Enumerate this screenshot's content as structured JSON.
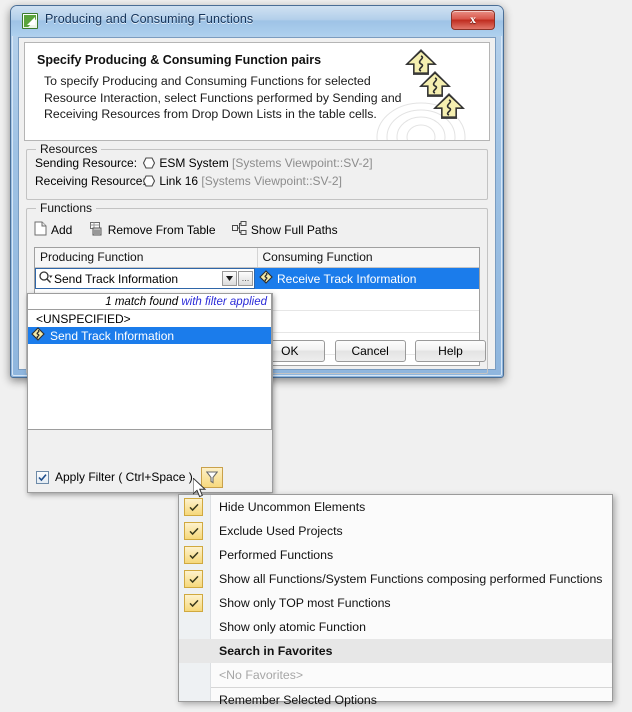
{
  "window": {
    "title": "Producing and Consuming Functions",
    "icon": "app-icon",
    "close_label": "x"
  },
  "banner": {
    "heading": "Specify Producing & Consuming Function pairs",
    "description": "To specify Producing and Consuming Functions for selected Resource Interaction, select Functions performed by Sending and Receiving Resources from Drop Down Lists in the table cells."
  },
  "resources": {
    "legend": "Resources",
    "rows": [
      {
        "label": "Sending Resource:",
        "name": "ESM System",
        "path": "[Systems Viewpoint::SV-2]"
      },
      {
        "label": "Receiving Resource:",
        "name": "Link 16",
        "path": "[Systems Viewpoint::SV-2]"
      }
    ]
  },
  "functions": {
    "legend": "Functions",
    "toolbar": [
      {
        "icon": "new-document-icon",
        "label": "Add"
      },
      {
        "icon": "remove-row-icon",
        "label": "Remove From Table"
      },
      {
        "icon": "show-full-paths-icon",
        "label": "Show Full Paths"
      }
    ],
    "table": {
      "columns": [
        "Producing Function",
        "Consuming Function"
      ],
      "rows": [
        {
          "producing": "Send Track Information",
          "consuming": "Receive Track Information",
          "consuming_selected": true
        }
      ]
    }
  },
  "editor": {
    "search_value": "Send Track Information",
    "search_placeholder": "",
    "dropdown_arrow": "▼",
    "ellipsis_label": "…"
  },
  "dropdown": {
    "match_prefix": "1 match found ",
    "match_suffix": "with filter applied",
    "items": [
      {
        "label": "<UNSPECIFIED>",
        "icon": "none",
        "selected": false
      },
      {
        "label": "Send Track Information",
        "icon": "function-icon",
        "selected": true
      }
    ],
    "apply_filter_label": "Apply Filter ( Ctrl+Space )",
    "apply_filter_checked": true,
    "filter_button_icon": "funnel-icon"
  },
  "dialog_buttons": [
    {
      "label": "OK"
    },
    {
      "label": "Cancel"
    },
    {
      "label": "Help"
    }
  ],
  "context_menu": {
    "items": [
      {
        "label": "Hide Uncommon Elements",
        "checked": true,
        "type": "check"
      },
      {
        "label": "Exclude Used Projects",
        "checked": true,
        "type": "check"
      },
      {
        "label": "Performed Functions",
        "checked": true,
        "type": "check"
      },
      {
        "label": "Show all Functions/System Functions composing performed Functions",
        "checked": true,
        "type": "check"
      },
      {
        "label": "Show only TOP most Functions",
        "checked": true,
        "type": "check"
      },
      {
        "label": "Show only atomic Function",
        "checked": false,
        "type": "check"
      },
      {
        "label": "Search in Favorites",
        "checked": false,
        "type": "header"
      },
      {
        "label": "<No Favorites>",
        "checked": false,
        "type": "disabled"
      },
      {
        "label": "Remember Selected Options",
        "checked": false,
        "type": "check"
      }
    ]
  },
  "colors": {
    "selection_blue": "#1b7ceb",
    "title_blue": "#14335a",
    "accent_yellow": "#f6d87a",
    "link_blue": "#2b2bd8",
    "muted_gray": "#8c8c8c"
  }
}
